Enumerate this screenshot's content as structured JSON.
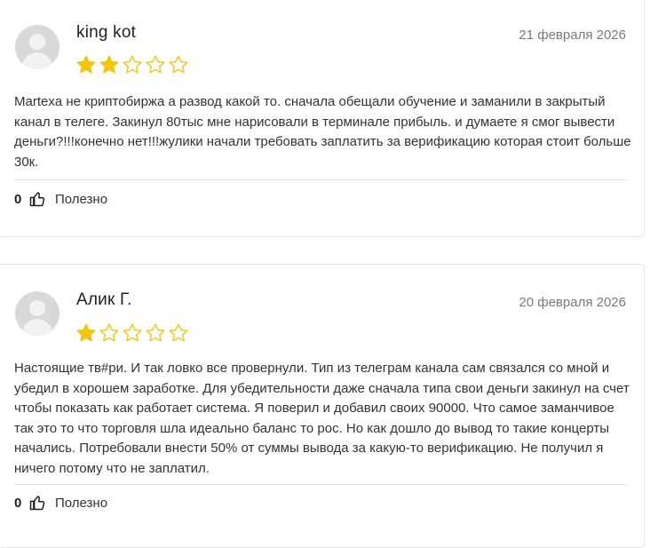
{
  "reviews": [
    {
      "author": "king kot",
      "date": "21 февраля 2026",
      "rating": 2,
      "max_rating": 5,
      "text": "Martexa не криптобиржа а развод какой то. сначала обещали обучение и заманили в закрытый канал в телеге. Закинул 80тыс мне нарисовали в терминале прибыль. и думаете я смог вывести деньги?!!!конечно нет!!!жулики начали требовать заплатить за верификацию которая стоит больше 30к.",
      "helpful_count": "0",
      "helpful_label": "Полезно"
    },
    {
      "author": "Алик Г.",
      "date": "20 февраля 2026",
      "rating": 1,
      "max_rating": 5,
      "text": "Настоящие тв#ри. И так ловко все провернули. Тип из телеграм канала сам связался со мной и убедил в хорошем заработке. Для убедительности даже сначала типа свои деньги закинул на счет чтобы показать как работает система. Я поверил и добавил своих 90000. Что самое заманчивое так это то что торговля шла идеально баланс то рос. Но как дошло до вывод то такие концерты начались. Потребовали внести 50% от суммы вывода за какую-то верификацию. Не получил я ничего потому что не заплатил.",
      "helpful_count": "0",
      "helpful_label": "Полезно"
    }
  ],
  "colors": {
    "star_filled": "#f2c511",
    "star_empty_stroke": "#f2c511",
    "border": "#e6e6e6",
    "date": "#7a7a7a"
  },
  "icons": {
    "avatar": "default-user-avatar",
    "star": "star-icon",
    "thumb": "thumbs-up-icon"
  }
}
